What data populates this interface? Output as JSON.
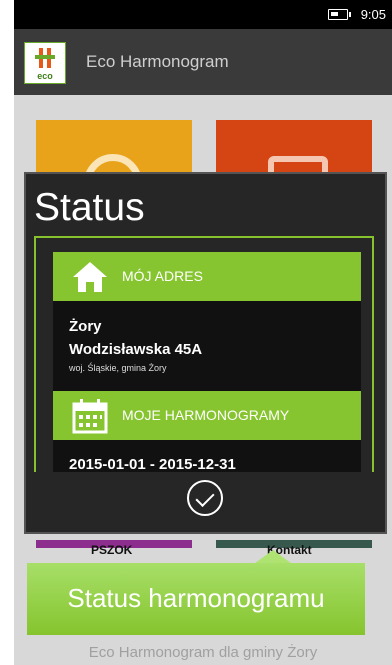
{
  "status_bar": {
    "time": "9:05",
    "battery_icon": "battery-icon"
  },
  "app": {
    "title": "Eco Harmonogram",
    "logo_text": "eco"
  },
  "tiles": [
    {
      "label": "PSZOK",
      "color": "#8d2d8d"
    },
    {
      "label": "Kontakt",
      "color": "#37594d"
    }
  ],
  "footer": "Eco Harmonogram dla gminy Żory",
  "dialog": {
    "title": "Status",
    "address_section": {
      "label": "MÓJ ADRES",
      "icon": "house-icon",
      "city": "Żory",
      "street": "Wodzisławska 45A",
      "region": "woj. Śląskie, gmina Żory"
    },
    "schedule_section": {
      "label": "MOJE HARMONOGRAMY",
      "icon": "calendar-icon",
      "range": "2015-01-01 - 2015-12-31"
    },
    "confirm_icon": "checkmark-icon"
  },
  "toast": {
    "text": "Status harmonogramu"
  },
  "colors": {
    "accent": "#86c52f",
    "dialog_bg": "#262626",
    "tile_yellow": "#e8a31a",
    "tile_red": "#d54513"
  }
}
